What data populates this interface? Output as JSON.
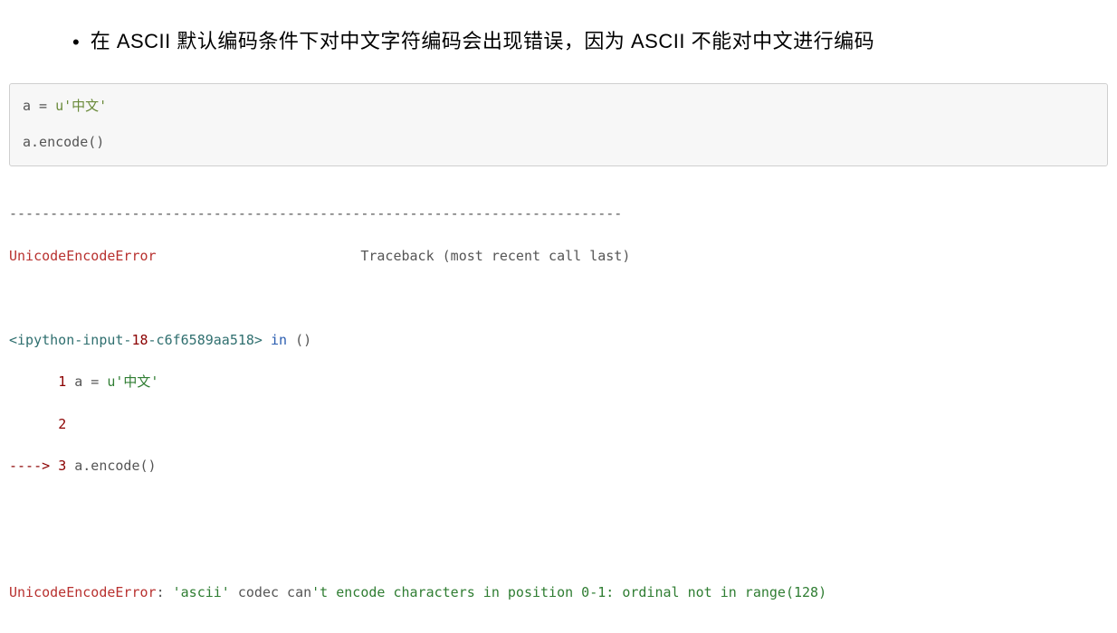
{
  "bullet": {
    "marker": "•",
    "text": "在 ASCII 默认编码条件下对中文字符编码会出现错误，因为 ASCII 不能对中文进行编码"
  },
  "code": {
    "line1_prefix": "a = ",
    "line1_str": "u'中文'",
    "line2_prefix": "a.encode",
    "line2_paren": "()"
  },
  "output": {
    "divider": "---------------------------------------------------------------------------",
    "err_name": "UnicodeEncodeError",
    "traceback_label": "                         Traceback (most recent call last)",
    "input_open": "<ipython-input-",
    "input_num": "18",
    "input_rest": "-c6f6589aa518>",
    "in_kw": " in ",
    "module_open": "(",
    "module_close": ")",
    "ln1_indent": "      ",
    "ln1_num": "1",
    "ln1_code_prefix": " a = ",
    "ln1_code_str": "u'中文'",
    "ln2_indent": "      ",
    "ln2_num": "2",
    "ln3_arrow": "----> ",
    "ln3_num": "3",
    "ln3_code": " a.encode()",
    "final_err": "UnicodeEncodeError",
    "final_colon": ": ",
    "final_msg_pre": "'ascii'",
    "final_msg_mid": " codec can",
    "final_msg_rest": "'t encode characters in position 0-1: ordinal not in range(128)"
  }
}
